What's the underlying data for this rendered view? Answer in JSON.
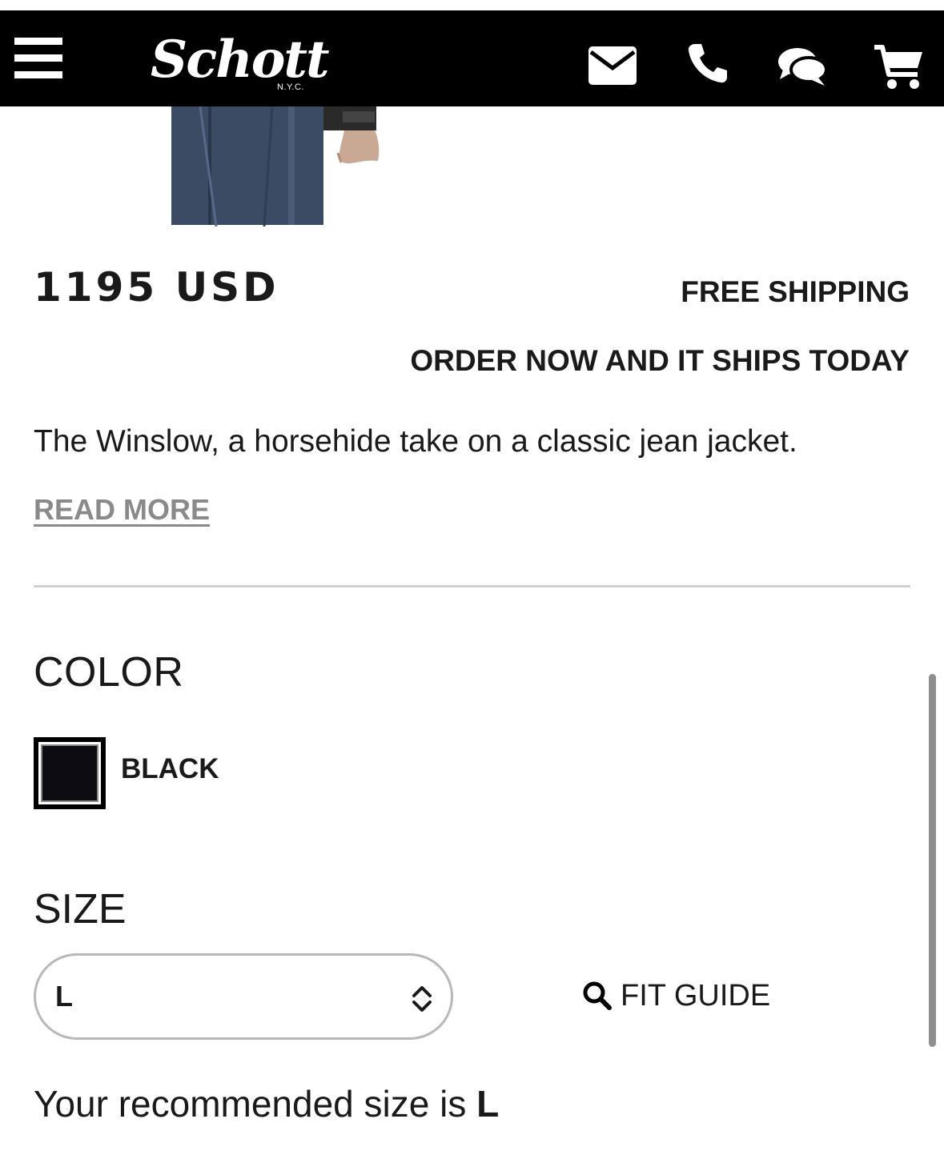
{
  "header": {
    "brand": "Schott",
    "brand_sub": "N.Y.C.",
    "icons": [
      "menu-icon",
      "mail-icon",
      "phone-icon",
      "chat-icon",
      "cart-icon"
    ]
  },
  "product": {
    "price": "1195 USD",
    "shipping": "FREE SHIPPING",
    "ships_today": "ORDER NOW AND IT SHIPS TODAY",
    "description": "The Winslow, a horsehide take on a classic jean jacket.",
    "read_more": "READ MORE"
  },
  "color": {
    "heading": "COLOR",
    "selected": "BLACK",
    "swatch_color": "#0c0c12"
  },
  "size": {
    "heading": "SIZE",
    "selected": "L",
    "fit_guide": "FIT GUIDE",
    "recommend_prefix": "Your recommended size is",
    "recommend_value": "L"
  },
  "colors": {
    "header_bg": "#000000",
    "text": "#1a1a1a",
    "link_muted": "#8a8a8a"
  }
}
